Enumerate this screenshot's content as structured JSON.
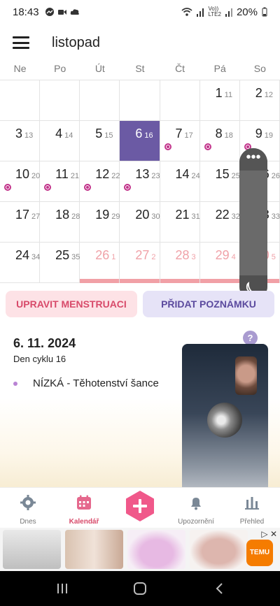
{
  "status_bar": {
    "time": "18:43",
    "network": "Vo))\nLTE2",
    "battery": "20%"
  },
  "header": {
    "month": "listopad"
  },
  "weekdays": [
    "Ne",
    "Po",
    "Út",
    "St",
    "Čt",
    "Pá",
    "So"
  ],
  "calendar": {
    "rows": [
      [
        null,
        null,
        null,
        null,
        null,
        {
          "d": "1",
          "c": "11"
        },
        {
          "d": "2",
          "c": "12"
        }
      ],
      [
        {
          "d": "3",
          "c": "13"
        },
        {
          "d": "4",
          "c": "14"
        },
        {
          "d": "5",
          "c": "15"
        },
        {
          "d": "6",
          "c": "16",
          "selected": true
        },
        {
          "d": "7",
          "c": "17",
          "mark": true
        },
        {
          "d": "8",
          "c": "18",
          "mark": true
        },
        {
          "d": "9",
          "c": "19",
          "mark": true
        }
      ],
      [
        {
          "d": "10",
          "c": "20",
          "mark": true
        },
        {
          "d": "11",
          "c": "21",
          "mark": true
        },
        {
          "d": "12",
          "c": "22",
          "mark": true
        },
        {
          "d": "13",
          "c": "23",
          "mark": true
        },
        {
          "d": "14",
          "c": "24"
        },
        {
          "d": "15",
          "c": "25"
        },
        {
          "d": "16",
          "c": "26"
        }
      ],
      [
        {
          "d": "17",
          "c": "27"
        },
        {
          "d": "18",
          "c": "28"
        },
        {
          "d": "19",
          "c": "29"
        },
        {
          "d": "20",
          "c": "30"
        },
        {
          "d": "21",
          "c": "31"
        },
        {
          "d": "22",
          "c": "32"
        },
        {
          "d": "23",
          "c": "33"
        }
      ],
      [
        {
          "d": "24",
          "c": "34"
        },
        {
          "d": "25",
          "c": "35"
        },
        {
          "d": "26",
          "c": "1",
          "pred": true
        },
        {
          "d": "27",
          "c": "2",
          "pred": true
        },
        {
          "d": "28",
          "c": "3",
          "pred": true
        },
        {
          "d": "29",
          "c": "4",
          "pred": true
        },
        {
          "d": "30",
          "c": "5",
          "pred": true
        }
      ]
    ]
  },
  "buttons": {
    "period": "UPRAVIT MENSTRUACI",
    "note": "PŘIDAT POZNÁMKU"
  },
  "detail": {
    "date": "6. 11. 2024",
    "cycle_day": "Den cyklu 16",
    "help": "?",
    "fertility": "NÍZKÁ - Těhotenství šance"
  },
  "call_widget": {
    "menu": "•••"
  },
  "nav": {
    "today": "Dnes",
    "calendar": "Kalendář",
    "reminders": "Upozornění",
    "overview": "Přehled"
  },
  "ad": {
    "brand": "TEMU",
    "close": "▷ ✕"
  },
  "colors": {
    "selected_day": "#6b5aa4",
    "period_pink": "#f1a0a6",
    "ovulation_mark": "#c2328a",
    "fab": "#f0588a"
  }
}
